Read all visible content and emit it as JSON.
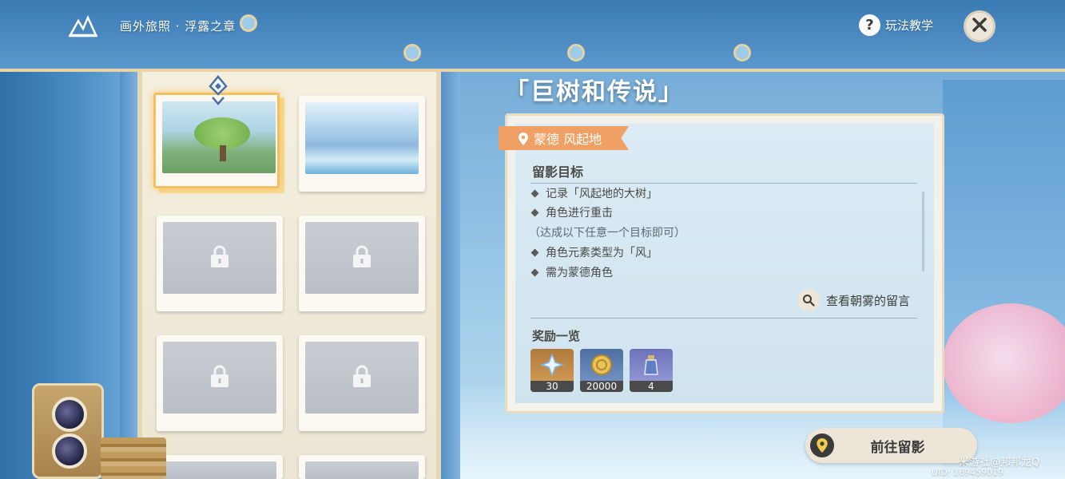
{
  "header": {
    "title": "画外旅照 · 浮露之章",
    "help_label": "玩法教学"
  },
  "quest": {
    "title": "「巨树和传说」",
    "location": "蒙德 风起地",
    "objectives_title": "留影目标",
    "objectives": [
      "记录「风起地的大树」",
      "角色进行重击"
    ],
    "note": "（达成以下任意一个目标即可）",
    "optional_objectives": [
      "角色元素类型为「风」",
      "需为蒙德角色"
    ],
    "view_messages_label": "查看朝雾的留言",
    "rewards_title": "奖励一览",
    "rewards": [
      {
        "name": "primogem-icon",
        "count": "30"
      },
      {
        "name": "mora-icon",
        "count": "20000"
      },
      {
        "name": "heros-wit-icon",
        "count": "4"
      }
    ],
    "go_button_label": "前往留影"
  },
  "album": {
    "cards": [
      {
        "state": "unlocked",
        "scene": "great-tree",
        "selected": true
      },
      {
        "state": "unlocked",
        "scene": "waterfall-city",
        "selected": false
      },
      {
        "state": "locked"
      },
      {
        "state": "locked"
      },
      {
        "state": "locked"
      },
      {
        "state": "locked"
      }
    ]
  },
  "footer": {
    "watermark": "米游社@邦邦龙Q",
    "uid": "UID: 169459019"
  },
  "colors": {
    "accent_orange": "#f0a064",
    "panel_bg": "#f6f3ea",
    "button_bg": "#ece5d8",
    "selected_border": "#f3c061"
  }
}
